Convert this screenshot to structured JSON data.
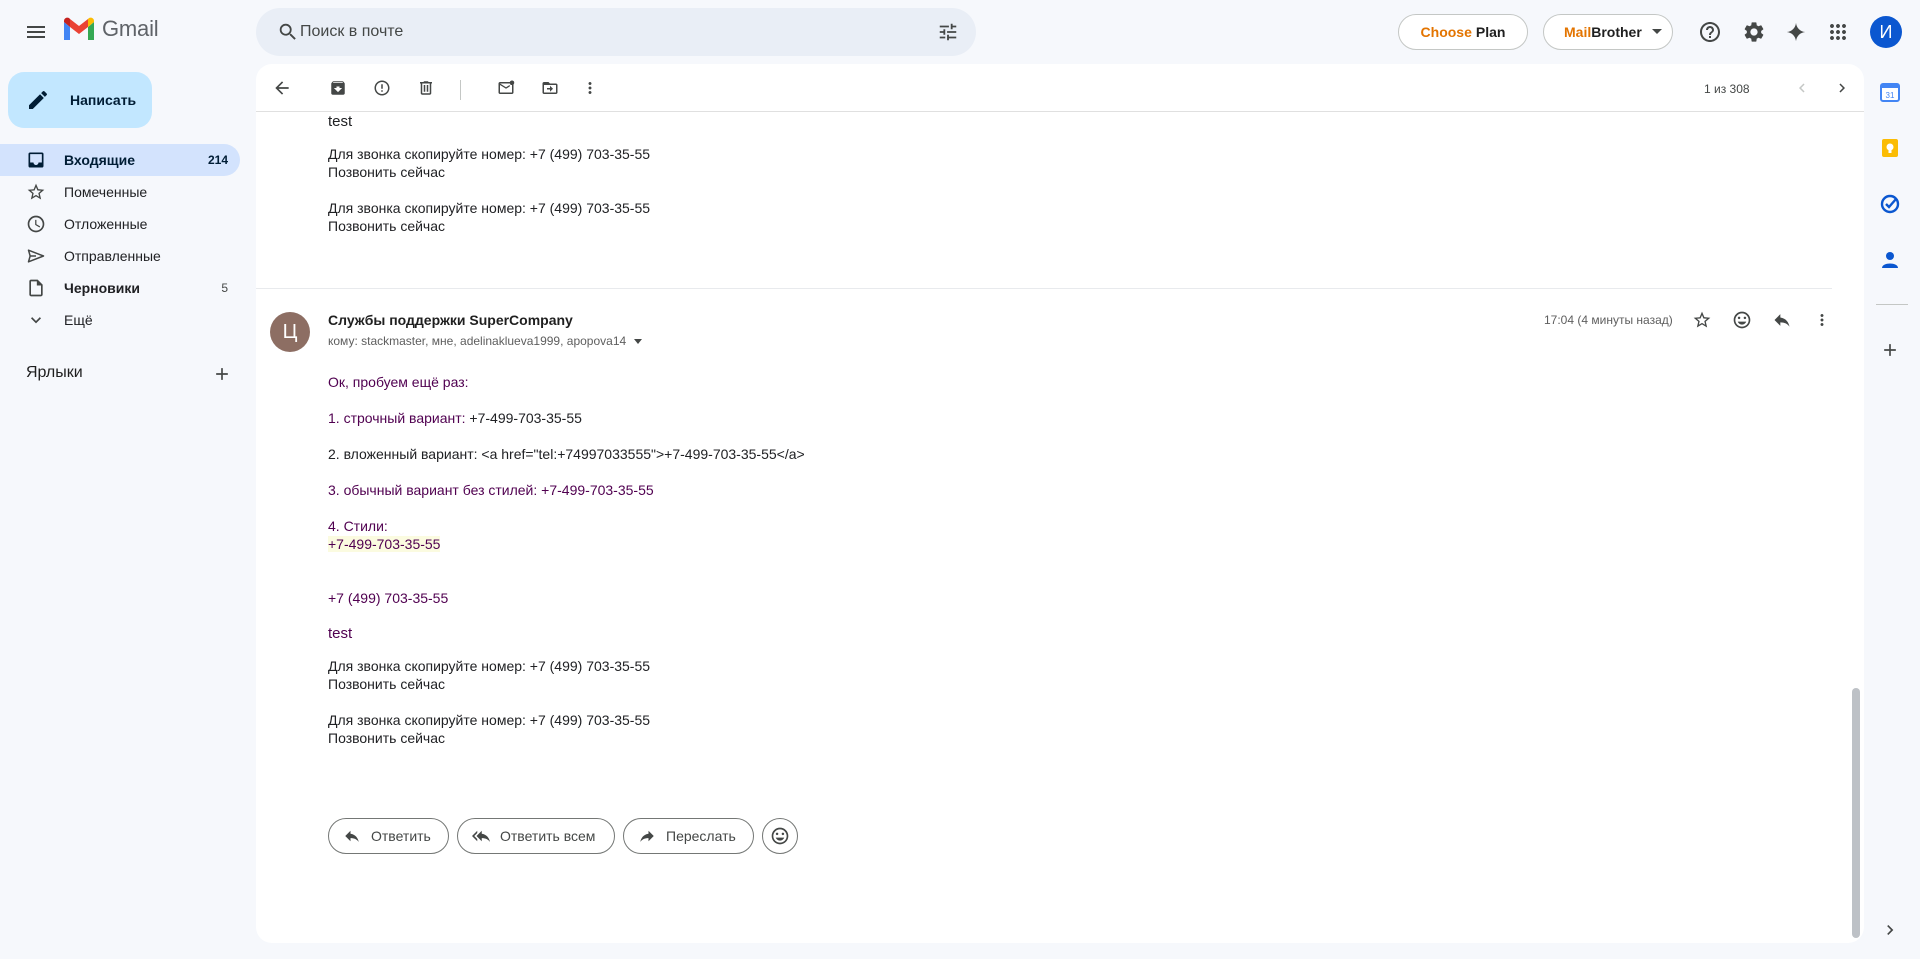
{
  "header": {
    "app_name": "Gmail",
    "search_placeholder": "Поиск в почте",
    "choose_plan_1": "Choose",
    "choose_plan_2": "Plan",
    "mailbrother_1": "Mail",
    "mailbrother_2": "Brother",
    "avatar_letter": "И"
  },
  "sidebar": {
    "compose_label": "Написать",
    "items": [
      {
        "label": "Входящие",
        "count": "214",
        "icon": "inbox-icon"
      },
      {
        "label": "Помеченные",
        "count": "",
        "icon": "star-icon"
      },
      {
        "label": "Отложенные",
        "count": "",
        "icon": "clock-icon"
      },
      {
        "label": "Отправленные",
        "count": "",
        "icon": "send-icon"
      },
      {
        "label": "Черновики",
        "count": "5",
        "icon": "draft-icon"
      },
      {
        "label": "Ещё",
        "count": "",
        "icon": "chevron-down-icon"
      }
    ],
    "labels_title": "Ярлыки"
  },
  "toolbar": {
    "pager": "1 из 308"
  },
  "prev_message": {
    "test": "test",
    "call_line_1": "Для звонка скопируйте номер: +7 (499) 703-35-55",
    "call_now_1": "Позвонить сейчас",
    "call_line_2": "Для звонка скопируйте номер: +7 (499) 703-35-55",
    "call_now_2": "Позвонить сейчас"
  },
  "message": {
    "sender_initial": "Ц",
    "sender_name": "Службы поддержки SuperCompany",
    "recipients": "кому: stackmaster, мне, adelinaklueva1999, apopova14",
    "time": "17:04 (4 минуты назад)",
    "body": {
      "intro": "Ок, пробуем ещё раз:",
      "line1_label": "1. строчный вариант: ",
      "line1_phone": "+7-499-703-35-55",
      "line2": "2. вложенный вариант: <a href=\"tel:+74997033555\">+7-499-703-35-55</a>",
      "line3_label": "3. обычный вариант без стилей: ",
      "line3_phone": "+7-499-703-35-55",
      "line4_label": "4. Стили:",
      "line4_phone": "+7-499-703-35-55",
      "phone_formatted": "+7 (499) 703-35-55",
      "test": "test",
      "call_line_1": "Для звонка скопируйте номер: +7 (499) 703-35-55",
      "call_now_1": "Позвонить сейчас",
      "call_line_2": "Для звонка скопируйте номер: +7 (499) 703-35-55",
      "call_now_2": "Позвонить сейчас"
    }
  },
  "actions": {
    "reply": "Ответить",
    "reply_all": "Ответить всем",
    "forward": "Переслать"
  },
  "colors": {
    "compose_bg": "#c2e7ff",
    "active_nav": "#d3e3fd",
    "link_purple": "#500050",
    "accent_orange": "#e37400",
    "avatar_blue": "#0b57d0"
  }
}
